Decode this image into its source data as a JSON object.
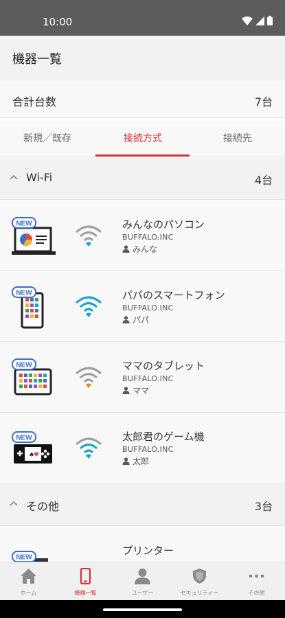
{
  "status_bar": {
    "time": "10:00"
  },
  "header": {
    "title": "機器一覧"
  },
  "summary": {
    "label": "合計台数",
    "value": "7台"
  },
  "tabs": [
    {
      "label": "新規／既存",
      "active": false
    },
    {
      "label": "接続方式",
      "active": true
    },
    {
      "label": "接続先",
      "active": false
    }
  ],
  "sections": [
    {
      "title": "Wi-Fi",
      "count": "4台",
      "devices": [
        {
          "name": "みんなのパソコン",
          "maker": "BUFFALO.INC",
          "owner": "みんな",
          "badge": "NEW",
          "icon": "laptop-icon",
          "wifi_color": "#9e9e9e"
        },
        {
          "name": "パパのスマートフォン",
          "maker": "BUFFALO.INC",
          "owner": "パパ",
          "badge": "NEW",
          "icon": "smartphone-icon",
          "wifi_color": "#1aa3c8"
        },
        {
          "name": "ママのタブレット",
          "maker": "BUFFALO.INC",
          "owner": "ママ",
          "badge": "NEW",
          "icon": "tablet-icon",
          "wifi_color": "#e08a1e"
        },
        {
          "name": "太郎君のゲーム機",
          "maker": "BUFFALO.INC",
          "owner": "太郎",
          "badge": "NEW",
          "icon": "game-console-icon",
          "wifi_color": "#1aa3c8"
        }
      ]
    },
    {
      "title": "その他",
      "count": "3台",
      "devices": [
        {
          "name": "プリンター",
          "badge": "NEW",
          "icon": "printer-icon"
        }
      ]
    }
  ],
  "bottom_nav": [
    {
      "label": "ホーム",
      "icon": "home-icon",
      "active": false
    },
    {
      "label": "機器一覧",
      "icon": "device-list-icon",
      "active": true
    },
    {
      "label": "ユーザー",
      "icon": "user-icon",
      "active": false
    },
    {
      "label": "セキュリティー",
      "icon": "shield-icon",
      "active": false
    },
    {
      "label": "その他",
      "icon": "more-icon",
      "active": false
    }
  ],
  "colors": {
    "accent": "#d6303a",
    "badge_blue": "#3b6fc4",
    "wifi_blue": "#1aa3c8",
    "wifi_orange": "#e08a1e"
  }
}
